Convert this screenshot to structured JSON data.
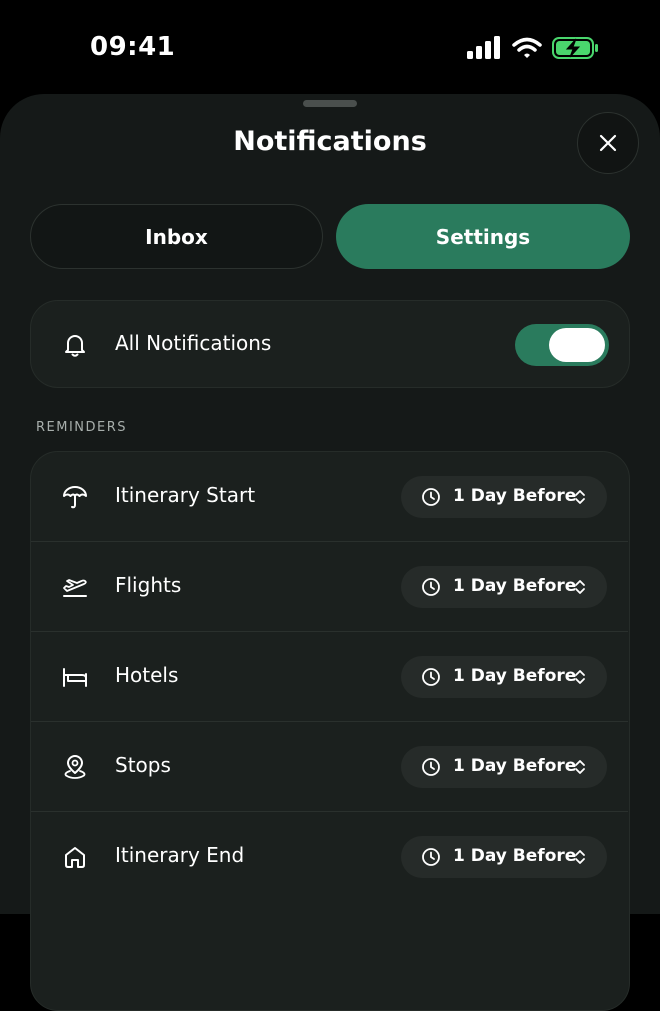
{
  "status_bar": {
    "time": "09:41"
  },
  "sheet": {
    "title": "Notifications",
    "tabs": {
      "inbox": "Inbox",
      "settings": "Settings",
      "selected": "Settings"
    }
  },
  "all_notifications": {
    "label": "All Notifications",
    "enabled": true
  },
  "reminders": {
    "section_label": "REMINDERS",
    "items": [
      {
        "label": "Itinerary Start",
        "icon": "umbrella-icon",
        "value": "1 Day Before"
      },
      {
        "label": "Flights",
        "icon": "plane-departure-icon",
        "value": "1 Day Before"
      },
      {
        "label": "Hotels",
        "icon": "bed-icon",
        "value": "1 Day Before"
      },
      {
        "label": "Stops",
        "icon": "map-pin-icon",
        "value": "1 Day Before"
      },
      {
        "label": "Itinerary End",
        "icon": "home-icon",
        "value": "1 Day Before"
      }
    ]
  },
  "colors": {
    "accent": "#2a7b5d",
    "battery": "#4ad66d"
  }
}
